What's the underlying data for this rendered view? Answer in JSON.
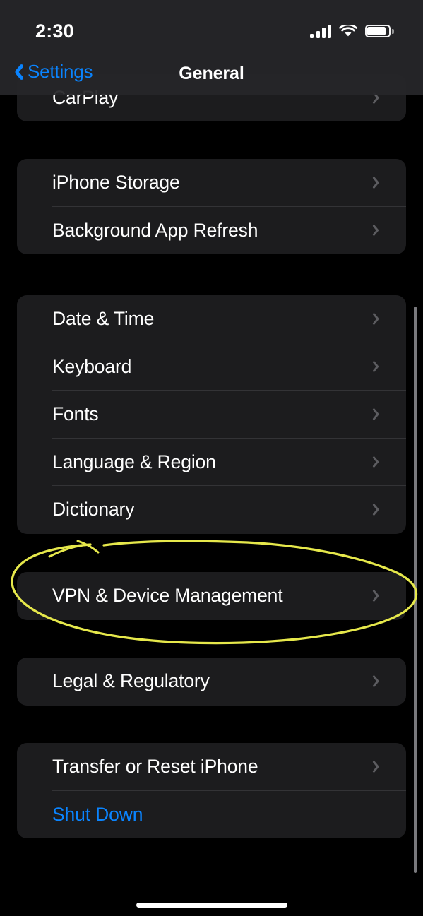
{
  "status_bar": {
    "time": "2:30",
    "signal_icon": "cellular-signal-icon",
    "wifi_icon": "wifi-icon",
    "battery_icon": "battery-icon",
    "battery_level_percent": 88
  },
  "nav_bar": {
    "back_label": "Settings",
    "back_icon": "chevron-left-icon",
    "title": "General"
  },
  "groups": [
    {
      "id": "carplay",
      "clipped_top": true,
      "rows": [
        {
          "label": "CarPlay",
          "accessory": "chevron-right-icon",
          "style": "default"
        }
      ]
    },
    {
      "id": "storage",
      "rows": [
        {
          "label": "iPhone Storage",
          "accessory": "chevron-right-icon",
          "style": "default"
        },
        {
          "label": "Background App Refresh",
          "accessory": "chevron-right-icon",
          "style": "default"
        }
      ]
    },
    {
      "id": "locale",
      "rows": [
        {
          "label": "Date & Time",
          "accessory": "chevron-right-icon",
          "style": "default"
        },
        {
          "label": "Keyboard",
          "accessory": "chevron-right-icon",
          "style": "default"
        },
        {
          "label": "Fonts",
          "accessory": "chevron-right-icon",
          "style": "default"
        },
        {
          "label": "Language & Region",
          "accessory": "chevron-right-icon",
          "style": "default"
        },
        {
          "label": "Dictionary",
          "accessory": "chevron-right-icon",
          "style": "default"
        }
      ]
    },
    {
      "id": "vpn",
      "rows": [
        {
          "label": "VPN & Device Management",
          "accessory": "chevron-right-icon",
          "style": "default"
        }
      ]
    },
    {
      "id": "legal",
      "rows": [
        {
          "label": "Legal & Regulatory",
          "accessory": "chevron-right-icon",
          "style": "default"
        }
      ]
    },
    {
      "id": "reset",
      "rows": [
        {
          "label": "Transfer or Reset iPhone",
          "accessory": "chevron-right-icon",
          "style": "default"
        },
        {
          "label": "Shut Down",
          "accessory": "none",
          "style": "accent"
        }
      ]
    }
  ],
  "annotation": {
    "type": "hand-drawn-ellipse",
    "color": "#e6e84b",
    "target_label": "VPN & Device Management"
  },
  "scrollbar": {
    "visible": true
  },
  "home_indicator": {
    "visible": true
  },
  "colors": {
    "page_background": "#000000",
    "card_background": "#1c1c1e",
    "nav_background": "#262629",
    "separator": "#333336",
    "primary_text": "#ffffff",
    "accent_blue": "#0a84ff",
    "chevron_gray": "#5c5c60",
    "annotation_yellow": "#e6e84b"
  }
}
